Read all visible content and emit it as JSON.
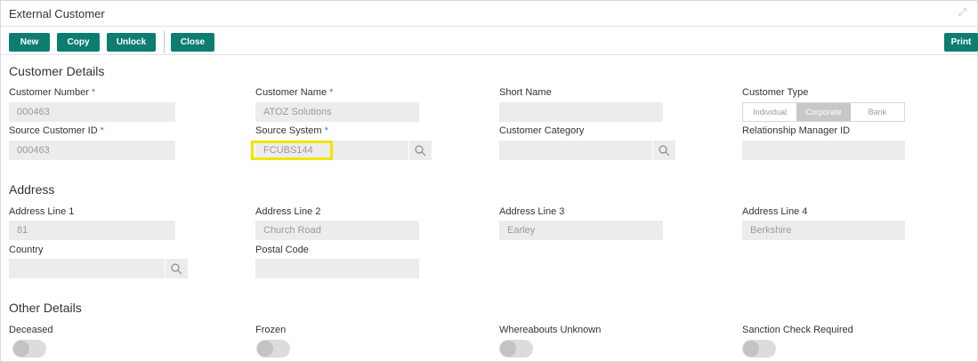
{
  "window": {
    "title": "External Customer"
  },
  "toolbar": {
    "new": "New",
    "copy": "Copy",
    "unlock": "Unlock",
    "close": "Close",
    "print": "Print"
  },
  "sections": {
    "customer_details": "Customer Details",
    "address": "Address",
    "other_details": "Other Details"
  },
  "fields": {
    "customer_number": {
      "label": "Customer Number",
      "value": "000463"
    },
    "customer_name": {
      "label": "Customer Name",
      "value": "ATOZ Solutions"
    },
    "short_name": {
      "label": "Short Name",
      "value": ""
    },
    "customer_type": {
      "label": "Customer Type",
      "options": [
        "Individual",
        "Corporate",
        "Bank"
      ],
      "selected": "Corporate"
    },
    "source_customer_id": {
      "label": "Source Customer ID",
      "value": "000463"
    },
    "source_system": {
      "label": "Source System",
      "value": "FCUBS144"
    },
    "customer_category": {
      "label": "Customer Category",
      "value": ""
    },
    "relationship_manager_id": {
      "label": "Relationship Manager ID",
      "value": ""
    },
    "address_line_1": {
      "label": "Address Line 1",
      "value": "81"
    },
    "address_line_2": {
      "label": "Address Line 2",
      "value": "Church Road"
    },
    "address_line_3": {
      "label": "Address Line 3",
      "value": "Earley"
    },
    "address_line_4": {
      "label": "Address Line 4",
      "value": "Berkshire"
    },
    "country": {
      "label": "Country",
      "value": ""
    },
    "postal_code": {
      "label": "Postal Code",
      "value": ""
    }
  },
  "toggles": {
    "deceased": {
      "label": "Deceased",
      "on": false
    },
    "frozen": {
      "label": "Frozen",
      "on": false
    },
    "whereabouts_unknown": {
      "label": "Whereabouts Unknown",
      "on": false
    },
    "sanction_check_required": {
      "label": "Sanction Check Required",
      "on": false
    }
  },
  "required_marker": "*",
  "colors": {
    "accent": "#0d7d72",
    "highlight": "#f3e500",
    "required": "#3b7fd6"
  }
}
